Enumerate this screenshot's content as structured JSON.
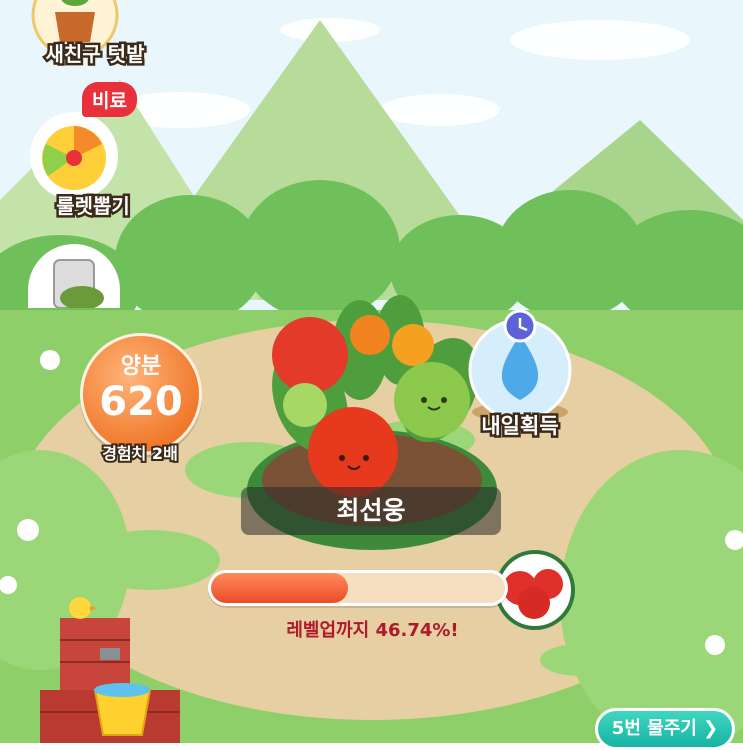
{
  "menu": {
    "new_friend_label": "새친구 텃밭",
    "roulette_badge": "비료",
    "roulette_label": "룰렛뽑기"
  },
  "nutrient": {
    "title": "양분",
    "value": "620",
    "subtitle": "경험치 2배"
  },
  "plant": {
    "owner_name": "최선웅"
  },
  "progress": {
    "percent": 46.74,
    "label": "레벨업까지 46.74%!"
  },
  "reward": {
    "label": "내일획득"
  },
  "water_button": {
    "label": "5번 물주기",
    "chevron": "chevron-right-icon"
  },
  "colors": {
    "sky": "#e9f6fb",
    "grass": "#8ecf6a",
    "dirt": "#e6cfa2",
    "progress_fill": "#ea4c2a",
    "accent_teal": "#1fbfae",
    "badge_red": "#e8313a"
  }
}
